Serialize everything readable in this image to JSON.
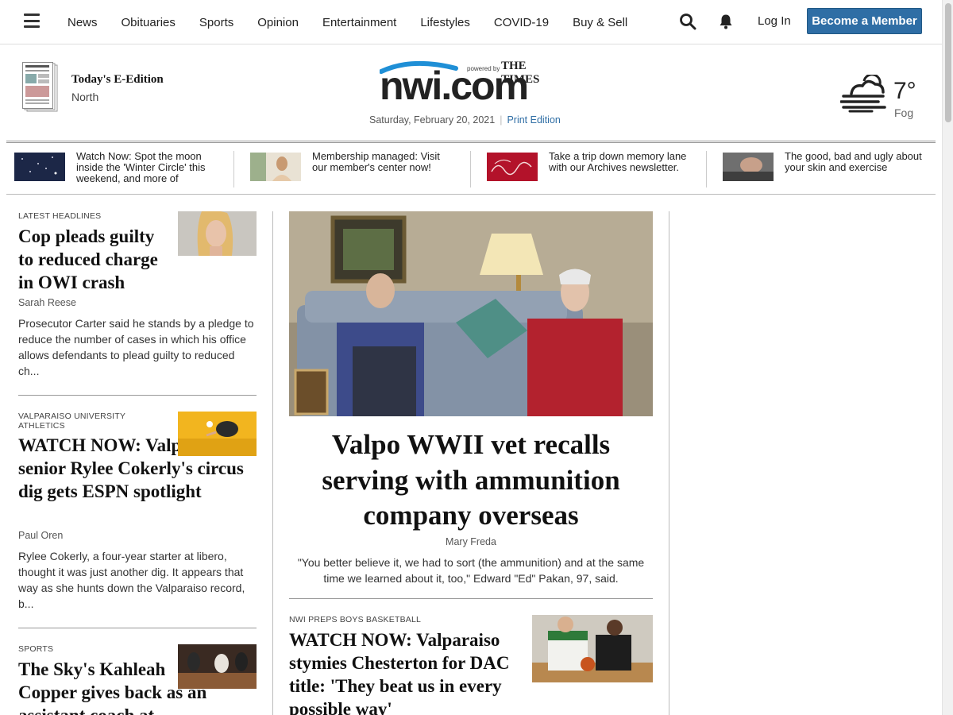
{
  "nav": {
    "items": [
      "News",
      "Obituaries",
      "Sports",
      "Opinion",
      "Entertainment",
      "Lifestyles",
      "COVID-19",
      "Buy & Sell"
    ],
    "login_label": "Log In",
    "member_label": "Become a Member",
    "icons": [
      "menu-icon",
      "search-icon",
      "bell-icon"
    ]
  },
  "masthead": {
    "eedition_title": "Today's E-Edition",
    "eedition_sub": "North",
    "logo_text": "nwi.com",
    "powered_by": "powered by",
    "times": "THE TIMES",
    "date": "Saturday, February 20, 2021",
    "print_edition": "Print Edition",
    "weather": {
      "temp": "7°",
      "condition": "Fog",
      "icon": "fog-icon"
    }
  },
  "promos": [
    {
      "text": "Watch Now: Spot the moon inside the 'Winter Circle' this weekend, and more of",
      "color": "#1f2a4a"
    },
    {
      "text": "Membership managed: Visit our member's center now!",
      "color": "#c9a27a"
    },
    {
      "text": "Take a trip down memory lane with our Archives newsletter.",
      "color": "#b3122a"
    },
    {
      "text": "The good, bad and ugly about your skin and exercise",
      "color": "#8a8a8a"
    }
  ],
  "left_column": [
    {
      "kicker": "LATEST HEADLINES",
      "headline": "Cop pleads guilty to reduced charge in OWI crash",
      "byline": "Sarah Reese",
      "summary": "Prosecutor Carter said he stands by a pledge to reduce the number of cases in which his office allows defendants to plead guilty to reduced ch..."
    },
    {
      "kicker": "VALPARAISO UNIVERSITY ATHLETICS",
      "headline": "WATCH NOW: Valparaiso senior Rylee Cokerly's circus dig gets ESPN spotlight",
      "byline": "Paul Oren",
      "summary": "Rylee Cokerly, a four-year starter at libero, thought it was just another dig. It appears that way as she hunts down the Valparaiso record, b..."
    },
    {
      "kicker": "SPORTS",
      "headline": "The Sky's Kahleah Copper gives back as an assistant coach at"
    }
  ],
  "center": {
    "lead": {
      "headline": "Valpo WWII vet recalls serving with ammunition company overseas",
      "byline": "Mary Freda",
      "summary": "\"You better believe it, we had to sort (the ammunition) and at the same time we learned about it, too,\" Edward \"Ed\" Pakan, 97, said."
    },
    "second": {
      "kicker": "NWI PREPS BOYS BASKETBALL",
      "headline": "WATCH NOW: Valparaiso stymies Chesterton for DAC title: 'They beat us in every possible way'"
    }
  }
}
